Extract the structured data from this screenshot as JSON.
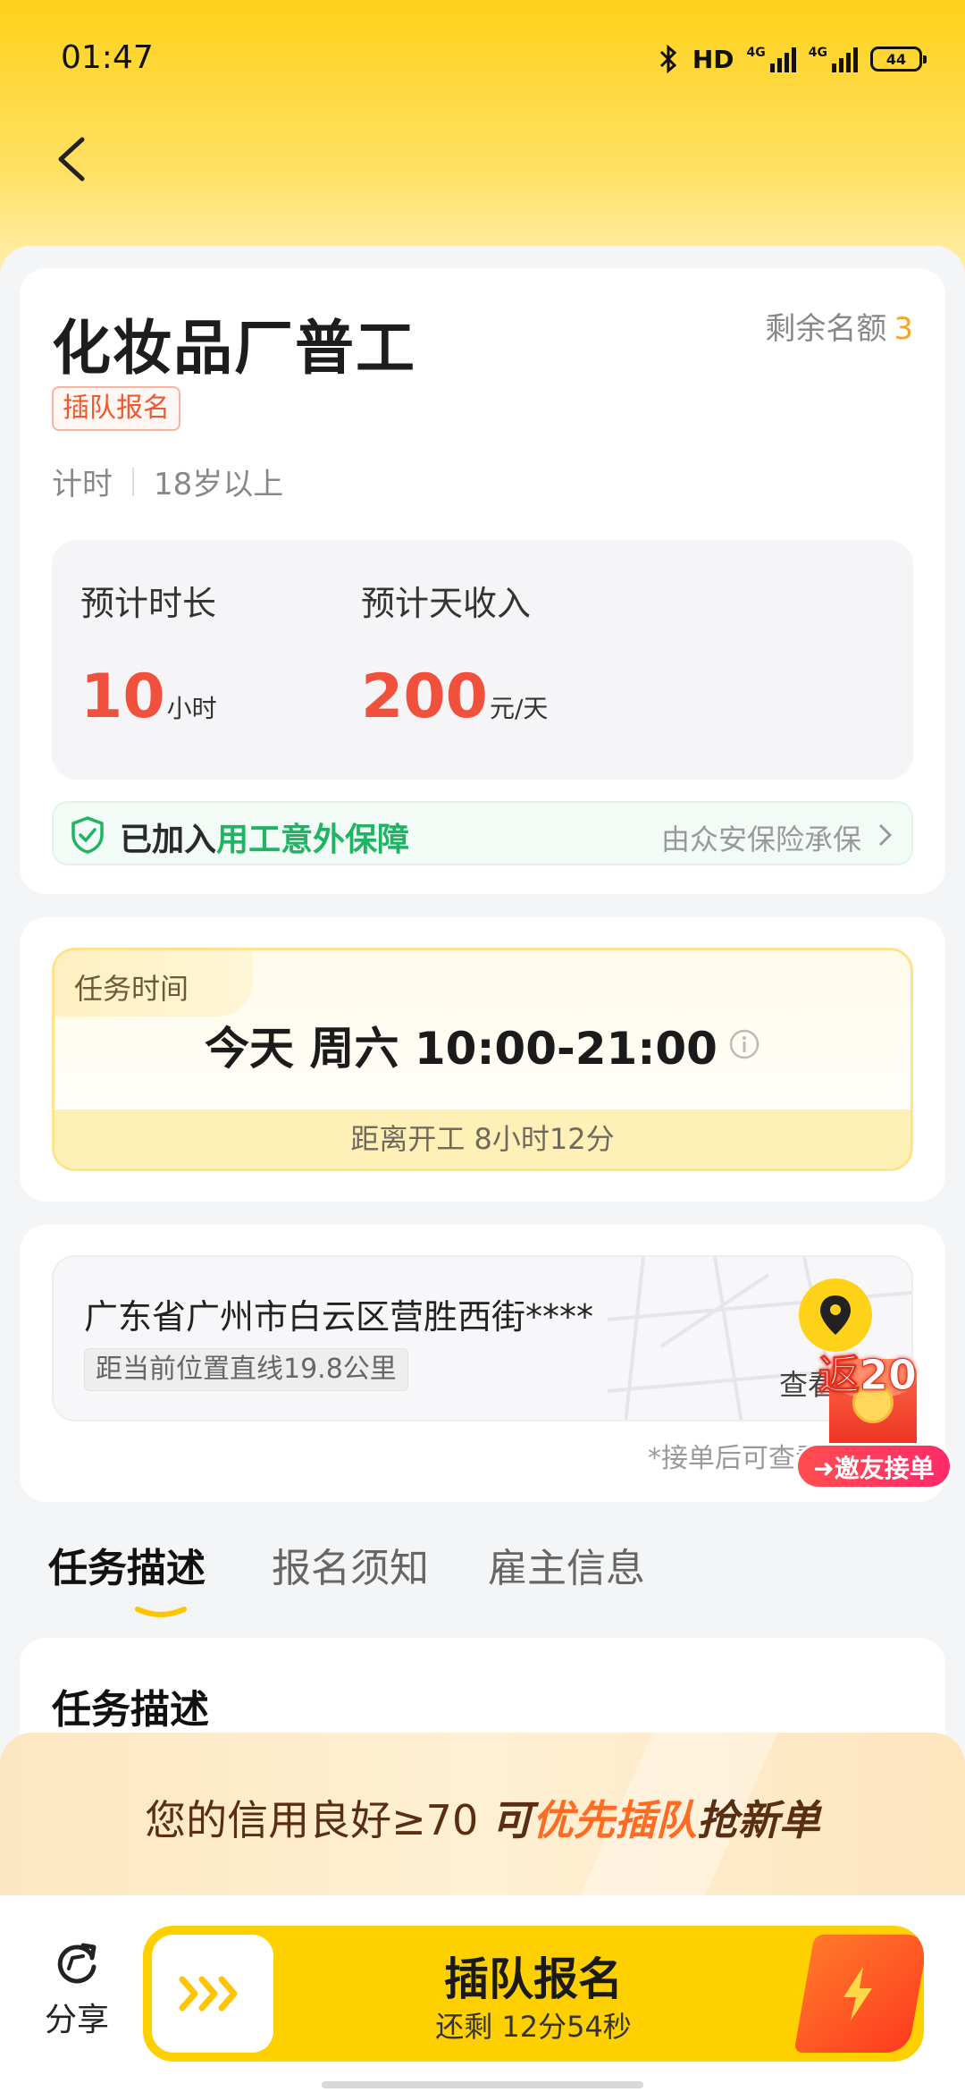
{
  "status_bar": {
    "time": "01:47",
    "hd": "HD",
    "net1": "4G",
    "net2": "4G",
    "battery": "44"
  },
  "job": {
    "title": "化妆品厂普工",
    "remain_label": "剩余名额",
    "remain_count": "3",
    "tag": "插队报名",
    "meta": [
      "计时",
      "18岁以上"
    ],
    "est_duration_label": "预计时长",
    "est_duration_value": "10",
    "est_duration_unit": "小时",
    "est_income_label": "预计天收入",
    "est_income_value": "200",
    "est_income_unit": "元/天"
  },
  "insurance": {
    "prefix": "已加入",
    "highlight": "用工意外保障",
    "provider": "由众安保险承保"
  },
  "task_time": {
    "tag": "任务时间",
    "main": "今天 周六 10:00-21:00",
    "countdown": "距离开工 8小时12分"
  },
  "address": {
    "text": "广东省广州市白云区营胜西街****",
    "distance": "距当前位置直线19.8公里",
    "view_label": "查看",
    "note": "*接单后可查看详"
  },
  "promo": {
    "amount": "返20",
    "invite": "➜邀友接单"
  },
  "tabs": [
    "任务描述",
    "报名须知",
    "雇主信息"
  ],
  "section_title": "任务描述",
  "credit_banner": {
    "part1": "您的信用良好≥70 ",
    "part2": "可",
    "part3": "优先插队",
    "part4": "抢新单"
  },
  "bottom": {
    "share_label": "分享",
    "cta_title": "插队报名",
    "cta_sub": "还剩 12分54秒"
  },
  "colors": {
    "brand_yellow": "#ffd000",
    "price_red": "#f0503c",
    "insurance_green": "#1fb463",
    "accent_orange": "#ff6b22"
  }
}
